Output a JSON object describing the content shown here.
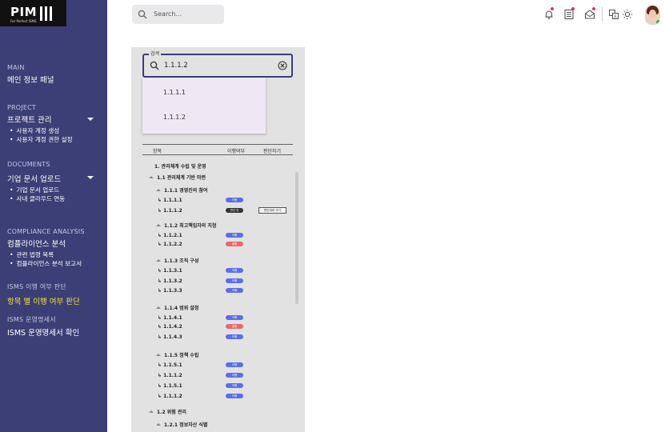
{
  "sidebar": {
    "logo_text": "PIM",
    "logo_tagline": "For Perfect ISMS",
    "sections": [
      {
        "caption": "MAIN",
        "title": "메인 정보 패널",
        "items": []
      },
      {
        "caption": "PROJECT",
        "title": "프로젝트 관리",
        "items": [
          "사용자 계정 생성",
          "사용자 계정 권한 설정"
        ]
      },
      {
        "caption": "DOCUMENTS",
        "title": "기업 문서 업로드",
        "items": [
          "기업 문서 업로드",
          "사내 클라우드 연동"
        ]
      },
      {
        "caption": "COMPLIANCE ANALYSIS",
        "title": "컴플라이언스 분석",
        "items": [
          "관련 법령 목록",
          "컴플라이언스 분석 보고서"
        ]
      },
      {
        "caption": "ISMS 이행 여부 판단",
        "title": "항목 별 이행 여부 판단",
        "items": []
      },
      {
        "caption": "ISMS 운영명세서",
        "title": "ISMS 운영명세서 확인",
        "items": []
      }
    ]
  },
  "topbar": {
    "search_placeholder": "Search...",
    "icons": [
      "bell-icon",
      "list-icon",
      "mail-icon",
      "translate-icon",
      "sun-icon"
    ]
  },
  "search_field": {
    "legend": "검색",
    "value": "1.1.1.2",
    "suggestions": [
      "1.1.1.1",
      "1.1.1.2"
    ]
  },
  "table": {
    "headers": [
      "항목",
      "이행여부",
      "판단하기"
    ],
    "judge_button": "판단하러 가기",
    "rows": [
      {
        "label": "1. 관리체계 수립 및 운영",
        "status": null,
        "status_color": null
      },
      {
        "label": "1.1 관리체계 기반 마련",
        "status": null,
        "status_color": null
      },
      {
        "label": "1.1.1 경영진의 참여",
        "status": null,
        "status_color": null
      },
      {
        "label": "1.1.1.1",
        "status": "이행",
        "status_color": "#5a6ee8"
      },
      {
        "label": "1.1.1.2",
        "status": "판단 전",
        "status_color": "#333333"
      },
      {
        "label": "1.1.2 최고책임자의 지정",
        "status": null,
        "status_color": null
      },
      {
        "label": "1.1.2.1",
        "status": "이행",
        "status_color": "#5a6ee8"
      },
      {
        "label": "1.1.2.2",
        "status": "결함",
        "status_color": "#e9686e"
      },
      {
        "label": "1.1.3 조직 구성",
        "status": null,
        "status_color": null
      },
      {
        "label": "1.1.3.1",
        "status": "이행",
        "status_color": "#5a6ee8"
      },
      {
        "label": "1.1.3.2",
        "status": "이행",
        "status_color": "#5a6ee8"
      },
      {
        "label": "1.1.3.3",
        "status": "이행",
        "status_color": "#5a6ee8"
      },
      {
        "label": "1.1.4 범위 설정",
        "status": null,
        "status_color": null
      },
      {
        "label": "1.1.4.1",
        "status": "이행",
        "status_color": "#5a6ee8"
      },
      {
        "label": "1.1.4.2",
        "status": "결함",
        "status_color": "#e9686e"
      },
      {
        "label": "1.1.4.3",
        "status": "이행",
        "status_color": "#5a6ee8"
      },
      {
        "label": "1.1.5 정책 수립",
        "status": null,
        "status_color": null
      },
      {
        "label": "1.1.5.1",
        "status": "이행",
        "status_color": "#5a6ee8"
      },
      {
        "label": "1.1.1.2",
        "status": "이행",
        "status_color": "#5a6ee8"
      },
      {
        "label": "1.1.5.1",
        "status": "이행",
        "status_color": "#5a6ee8"
      },
      {
        "label": "1.1.1.2",
        "status": "이행",
        "status_color": "#5a6ee8"
      },
      {
        "label": "1.2 위험 관리",
        "status": null,
        "status_color": null
      },
      {
        "label": "1.2.1 정보자산 식별",
        "status": null,
        "status_color": null
      }
    ]
  },
  "colors": {
    "sidebar_bg": "#3b3f75",
    "active_nav": "#f2e13b",
    "implemented": "#5a6ee8",
    "defect": "#e9686e",
    "notification_dot": "#e6335b"
  }
}
